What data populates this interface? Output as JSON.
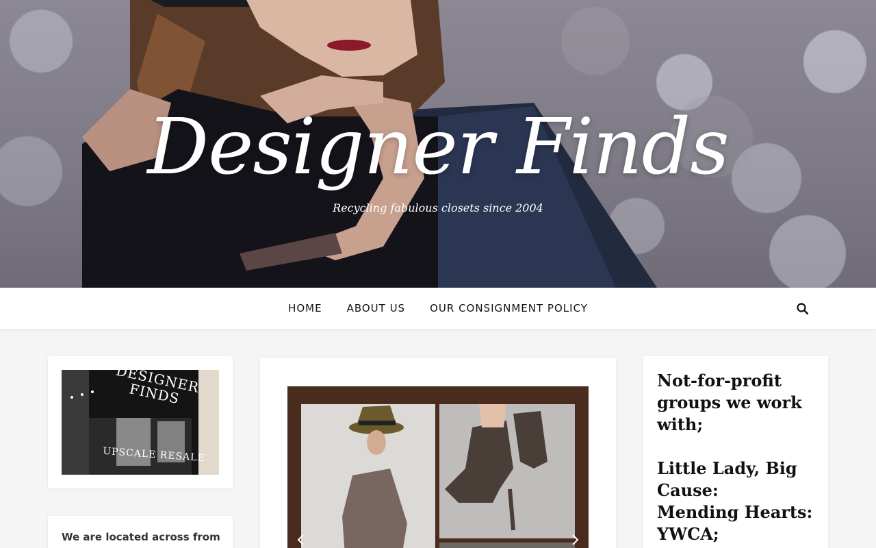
{
  "site": {
    "title": "Designer Finds",
    "tagline": "Recycling fabulous closets since 2004"
  },
  "nav": {
    "items": [
      "HOME",
      "ABOUT US",
      "OUR CONSIGNMENT POLICY"
    ]
  },
  "sidebar": {
    "logo_sign": "DESIGNER FINDS",
    "logo_sub": "UPSCALE RESALE",
    "location_text": "We are located across from"
  },
  "groups": {
    "heading": "Not-for-profit groups we work with;",
    "items": [
      "Little Lady, Big Cause:",
      "Mending Hearts:",
      "YWCA;"
    ]
  },
  "colors": {
    "accent_text": "#111111",
    "nav_bg": "#ffffff",
    "page_bg": "#f5f5f5"
  },
  "icons": {
    "search": "search-icon",
    "prev": "chevron-left-icon",
    "next": "chevron-right-icon"
  }
}
